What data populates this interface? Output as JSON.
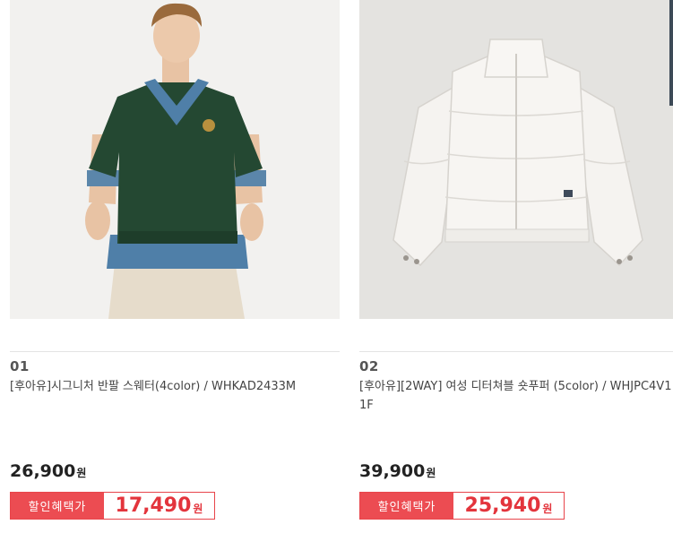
{
  "products": [
    {
      "rank": "01",
      "name": "[후아유]시그니처 반팔 스웨터(4color) / WHKAD2433M",
      "price": "26,900",
      "price_unit": "원",
      "discount_label": "할인혜택가",
      "discount_price": "17,490",
      "discount_unit": "원"
    },
    {
      "rank": "02",
      "name": "[후아유][2WAY] 여성 디터쳐블 숏푸퍼 (5color) / WHJPC4V11F",
      "price": "39,900",
      "price_unit": "원",
      "discount_label": "할인혜택가",
      "discount_price": "25,940",
      "discount_unit": "원"
    }
  ],
  "colors": {
    "discount_red": "#ec4c52",
    "discount_text": "#e3343c",
    "sweater_green": "#244832",
    "denim_blue": "#4f7fa8",
    "puffer_white": "#f4f2ef"
  }
}
